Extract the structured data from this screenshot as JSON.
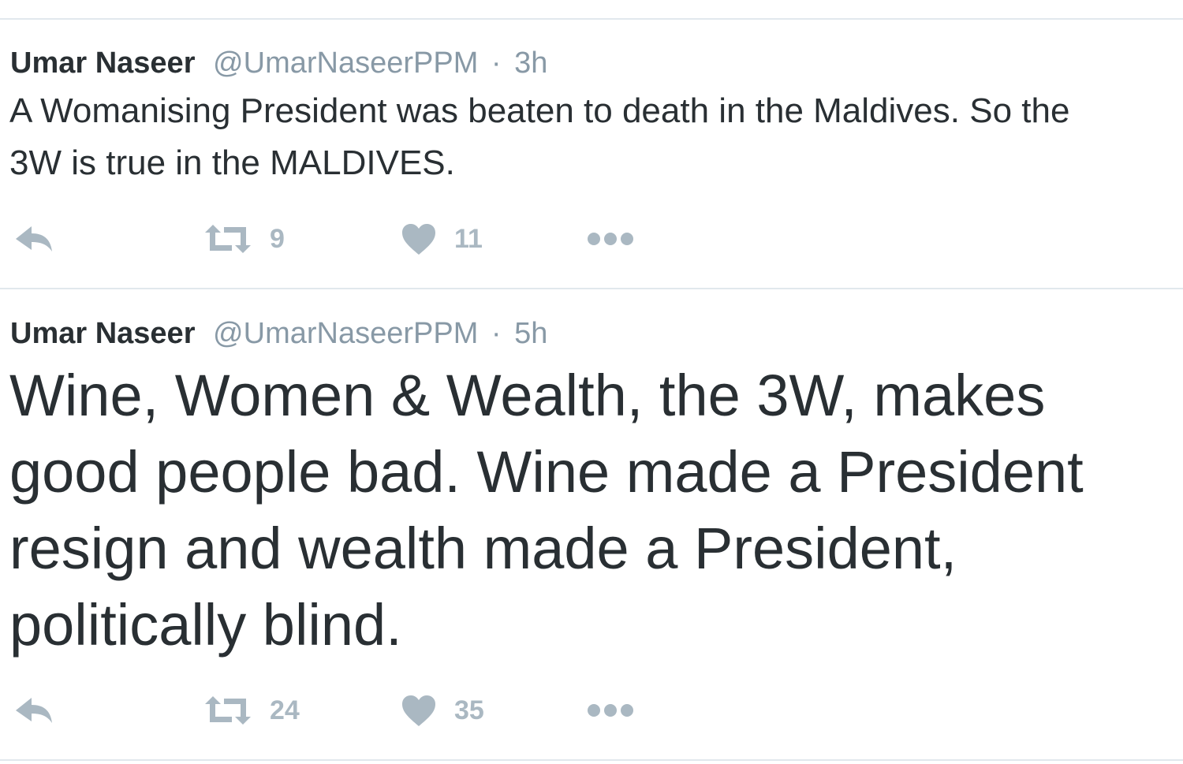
{
  "tweets": [
    {
      "name": "Umar Naseer",
      "handle": "@UmarNaseerPPM",
      "separator": "·",
      "time": "3h",
      "text": "A Womanising President was beaten to death in the Maldives. So the\n3W is true in the MALDIVES.",
      "retweets": "9",
      "likes": "11"
    },
    {
      "name": "Umar Naseer",
      "handle": "@UmarNaseerPPM",
      "separator": "·",
      "time": "5h",
      "text": "Wine, Women & Wealth, the 3W, makes\ngood people bad. Wine made a President\nresign and wealth made a President,\npolitically blind.",
      "retweets": "24",
      "likes": "35"
    }
  ],
  "icons": {
    "reply": "reply-icon",
    "retweet": "retweet-icon",
    "like": "heart-icon",
    "more": "more-dots-icon"
  },
  "colors": {
    "text": "#292f33",
    "muted": "#8899a6",
    "icon": "#aab8c2",
    "divider": "#e1e8ed"
  }
}
